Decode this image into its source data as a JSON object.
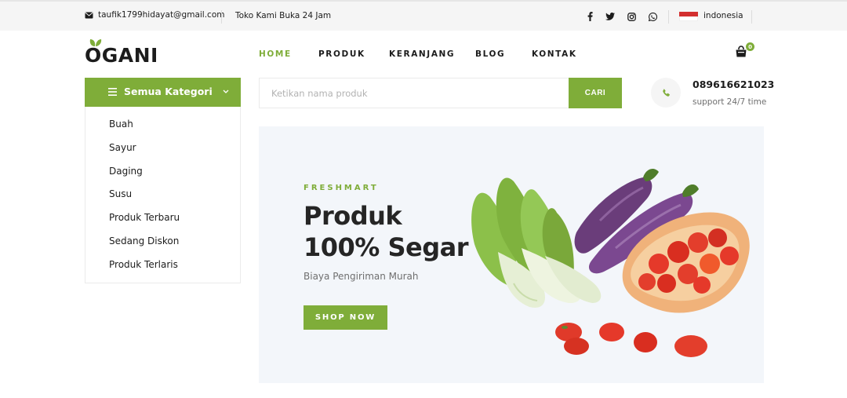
{
  "topbar": {
    "email": "taufik1799hidayat@gmail.com",
    "hours": "Toko Kami Buka 24 Jam",
    "social_icons": [
      "facebook-icon",
      "twitter-icon",
      "instagram-icon",
      "whatsapp-icon"
    ],
    "language": "indonesia"
  },
  "header": {
    "logo": "OGANI",
    "nav": [
      "HOME",
      "PRODUK",
      "KERANJANG",
      "BLOG",
      "KONTAK"
    ],
    "active_nav": "HOME",
    "cart_count": "0"
  },
  "categories": {
    "button_label": "Semua Kategori",
    "items": [
      "Buah",
      "Sayur",
      "Daging",
      "Susu",
      "Produk Terbaru",
      "Sedang Diskon",
      "Produk Terlaris"
    ]
  },
  "search": {
    "placeholder": "Ketikan nama produk",
    "value": "",
    "button_label": "CARI"
  },
  "contact": {
    "phone": "089616621023",
    "support": "support 24/7 time"
  },
  "hero": {
    "eyebrow": "FRESHMART",
    "title_line1": "Produk",
    "title_line2": "100% Segar",
    "subtitle": "Biaya Pengiriman Murah",
    "button_label": "SHOP NOW"
  },
  "colors": {
    "accent": "#7fad39",
    "text": "#1c1c1c",
    "topbar_bg": "#f5f5f5",
    "hero_bg": "#f3f6fa"
  }
}
